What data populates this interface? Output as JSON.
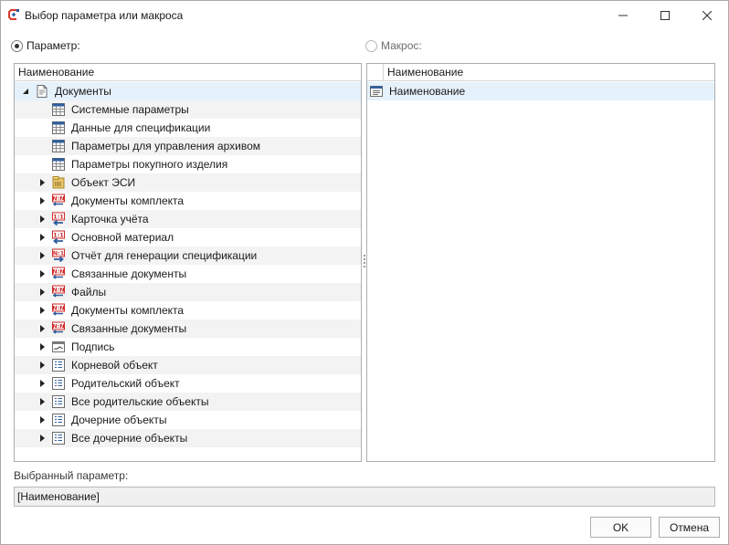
{
  "window": {
    "title": "Выбор параметра или макроса",
    "app_icon": "tflex-cad-icon",
    "controls": [
      "minimize-icon",
      "maximize-icon",
      "close-icon"
    ]
  },
  "mode": {
    "parameter_label": "Параметр:",
    "parameter_selected": true,
    "macro_label": "Макрос:",
    "macro_selected": false
  },
  "left_panel": {
    "column_header": "Наименование",
    "items": [
      {
        "label": "Документы",
        "icon": "document-icon",
        "expander": "expanded"
      },
      {
        "label": "Системные параметры",
        "icon": "table-icon"
      },
      {
        "label": "Данные для спецификации",
        "icon": "table-icon"
      },
      {
        "label": "Параметры для управления архивом",
        "icon": "table-icon"
      },
      {
        "label": "Параметры покупного изделия",
        "icon": "table-icon"
      },
      {
        "label": "Объект ЭСИ",
        "icon": "eso-object-icon",
        "expander": "collapsed"
      },
      {
        "label": "Документы комплекта",
        "icon": "link-nn-icon",
        "expander": "collapsed"
      },
      {
        "label": "Карточка учёта",
        "icon": "link-back-icon",
        "expander": "collapsed"
      },
      {
        "label": "Основной материал",
        "icon": "link-back-icon",
        "expander": "collapsed"
      },
      {
        "label": "Отчёт для генерации спецификации",
        "icon": "link-forward-icon",
        "expander": "collapsed"
      },
      {
        "label": "Связанные документы",
        "icon": "link-nn-icon",
        "expander": "collapsed"
      },
      {
        "label": "Файлы",
        "icon": "link-nn-icon",
        "expander": "collapsed"
      },
      {
        "label": "Документы комплекта",
        "icon": "link-nn-icon",
        "expander": "collapsed"
      },
      {
        "label": "Связанные документы",
        "icon": "link-nn-icon",
        "expander": "collapsed"
      },
      {
        "label": "Подпись",
        "icon": "signature-icon",
        "expander": "collapsed"
      },
      {
        "label": "Корневой объект",
        "icon": "object-list-icon",
        "expander": "collapsed"
      },
      {
        "label": "Родительский объект",
        "icon": "object-list-icon",
        "expander": "collapsed"
      },
      {
        "label": "Все родительские объекты",
        "icon": "object-list-icon",
        "expander": "collapsed"
      },
      {
        "label": "Дочерние объекты",
        "icon": "object-list-icon",
        "expander": "collapsed"
      },
      {
        "label": "Все дочерние объекты",
        "icon": "object-list-icon",
        "expander": "collapsed"
      }
    ]
  },
  "right_panel": {
    "column_header": "Наименование",
    "items": [
      {
        "label": "Наименование",
        "icon": "text-field-icon",
        "selected": true
      }
    ]
  },
  "selected_parameter": {
    "label": "Выбранный параметр:",
    "value": "[Наименование]"
  },
  "buttons": {
    "ok": "OK",
    "cancel": "Отмена"
  },
  "colors": {
    "selection": "#e5f1fb",
    "alt_row": "#f3f3f3",
    "icon_blue": "#2e5f9e",
    "icon_red": "#d22a2a"
  }
}
